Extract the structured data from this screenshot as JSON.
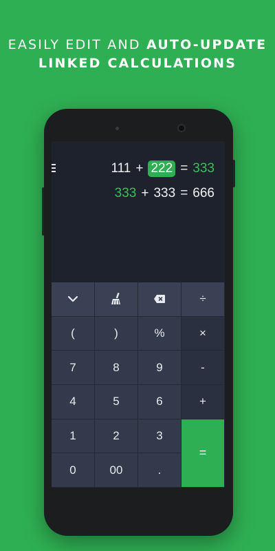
{
  "headline": {
    "line1_normal": "EASILY EDIT AND ",
    "line1_bold": "AUTO-UPDATE",
    "line2_bold": "LINKED CALCULATIONS"
  },
  "display": {
    "line1": {
      "a": "111",
      "op": "+",
      "b": "222",
      "eq": "=",
      "result": "333"
    },
    "line2": {
      "a": "333",
      "op": "+",
      "b": "333",
      "eq": "=",
      "result": "666"
    }
  },
  "keypad": {
    "top_row": [
      {
        "icon": "chevron-down-icon"
      },
      {
        "icon": "broom-icon"
      },
      {
        "icon": "backspace-icon"
      },
      {
        "label": "÷"
      }
    ],
    "rows": [
      [
        "(",
        ")",
        "%",
        "×"
      ],
      [
        "7",
        "8",
        "9",
        "-"
      ],
      [
        "4",
        "5",
        "6",
        "+"
      ],
      [
        "1",
        "2",
        "3"
      ],
      [
        "0",
        "00",
        "."
      ]
    ],
    "equals": "="
  },
  "colors": {
    "background": "#2faf53",
    "accent": "#2faf53",
    "screen": "#1e222d",
    "key": "#323a4c"
  }
}
